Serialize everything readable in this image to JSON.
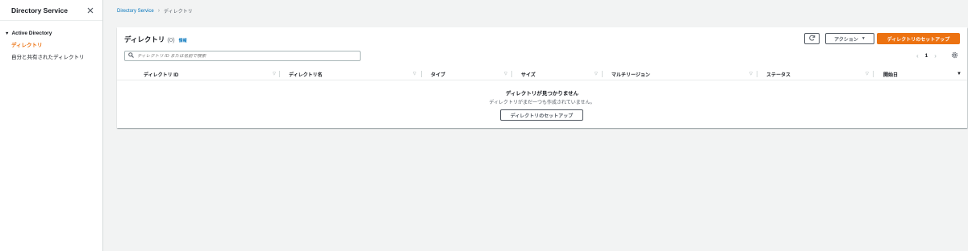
{
  "sidebar": {
    "title": "Directory Service",
    "section_title": "Active Directory",
    "items": [
      {
        "label": "ディレクトリ",
        "active": true
      },
      {
        "label": "自分と共有されたディレクトリ",
        "active": false
      }
    ]
  },
  "breadcrumb": {
    "root": "Directory Service",
    "current": "ディレクトリ"
  },
  "panel": {
    "title": "ディレクトリ",
    "count": "(0)",
    "info": "情報",
    "actions_label": "アクション",
    "primary_label": "ディレクトリのセットアップ"
  },
  "search": {
    "placeholder": "ディレクトリ ID または名前で検索"
  },
  "pagination": {
    "current_page": "1"
  },
  "table": {
    "columns": [
      "ディレクトリ ID",
      "ディレクトリ名",
      "タイプ",
      "サイズ",
      "マルチリージョン",
      "ステータス",
      "開始日"
    ]
  },
  "empty_state": {
    "title": "ディレクトリが見つかりません",
    "description": "ディレクトリがまだ一つも作成されていません。",
    "button_label": "ディレクトリのセットアップ"
  },
  "colors": {
    "accent": "#ec7211",
    "link": "#0073bb",
    "background": "#f2f3f3"
  }
}
